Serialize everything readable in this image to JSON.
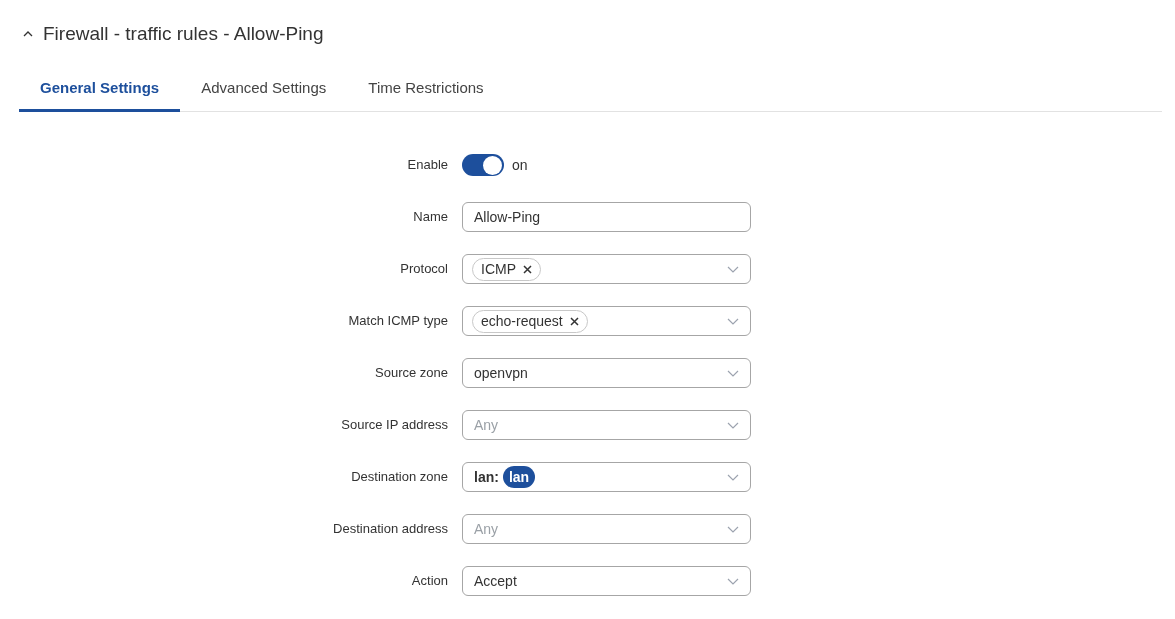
{
  "section": {
    "title": "Firewall - traffic rules - Allow-Ping",
    "expanded": true
  },
  "tabs": [
    {
      "label": "General Settings",
      "selected": true
    },
    {
      "label": "Advanced Settings",
      "selected": false
    },
    {
      "label": "Time Restrictions",
      "selected": false
    }
  ],
  "fields": [
    {
      "kind": "toggle",
      "label": "Enable",
      "on": true,
      "state_text": "on"
    },
    {
      "kind": "text",
      "label": "Name",
      "value": "Allow-Ping"
    },
    {
      "kind": "tags",
      "label": "Protocol",
      "tags": [
        "ICMP"
      ]
    },
    {
      "kind": "tags",
      "label": "Match ICMP type",
      "tags": [
        "echo-request"
      ]
    },
    {
      "kind": "select",
      "label": "Source zone",
      "value": "openvpn"
    },
    {
      "kind": "select",
      "label": "Source IP address",
      "placeholder": "Any"
    },
    {
      "kind": "zone",
      "label": "Destination zone",
      "prefix": "lan:",
      "badge": "lan"
    },
    {
      "kind": "select",
      "label": "Destination address",
      "placeholder": "Any"
    },
    {
      "kind": "select",
      "label": "Action",
      "value": "Accept"
    }
  ]
}
